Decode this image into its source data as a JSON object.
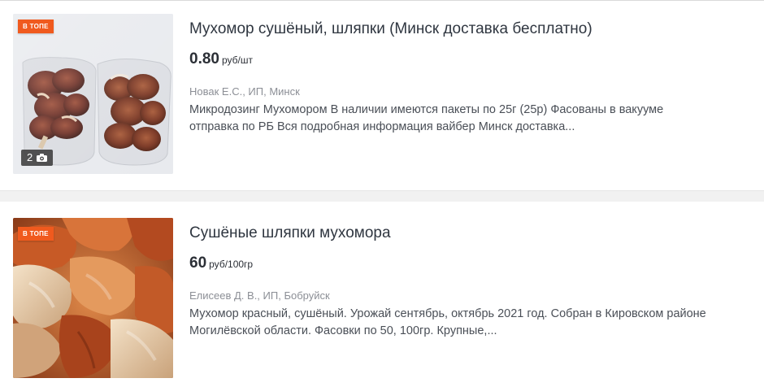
{
  "listings": [
    {
      "badge": "В ТОПЕ",
      "photo_count": "2",
      "title": "Мухомор сушёный, шляпки (Минск доставка бесплатно)",
      "price_value": "0.80",
      "price_unit": "руб/шт",
      "seller": "Новак Е.С., ИП, Минск",
      "description_line1": "Микродозинг Мухомором В наличии имеются пакеты по 25г (25р) Фасованы в вакууме",
      "description_line2": "отправка по РБ Вся подробная информация вайбер Минск доставка..."
    },
    {
      "badge": "В ТОПЕ",
      "title": "Сушёные шляпки мухомора",
      "price_value": "60",
      "price_unit": "руб/100гр",
      "seller": "Елисеев Д. В., ИП, Бобруйск",
      "description_line1": "Мухомор красный, сушёный. Урожай сентябрь, октябрь 2021 год. Собран в Кировском районе",
      "description_line2": "Могилёвской области. Фасовки по 50, 100гр. Крупные,..."
    }
  ],
  "icons": {
    "camera": "camera-icon"
  },
  "colors": {
    "badge": "#f05a1e",
    "title_text": "#2f3640",
    "seller_text": "#8c8f96",
    "separator": "#f1f1f1"
  }
}
